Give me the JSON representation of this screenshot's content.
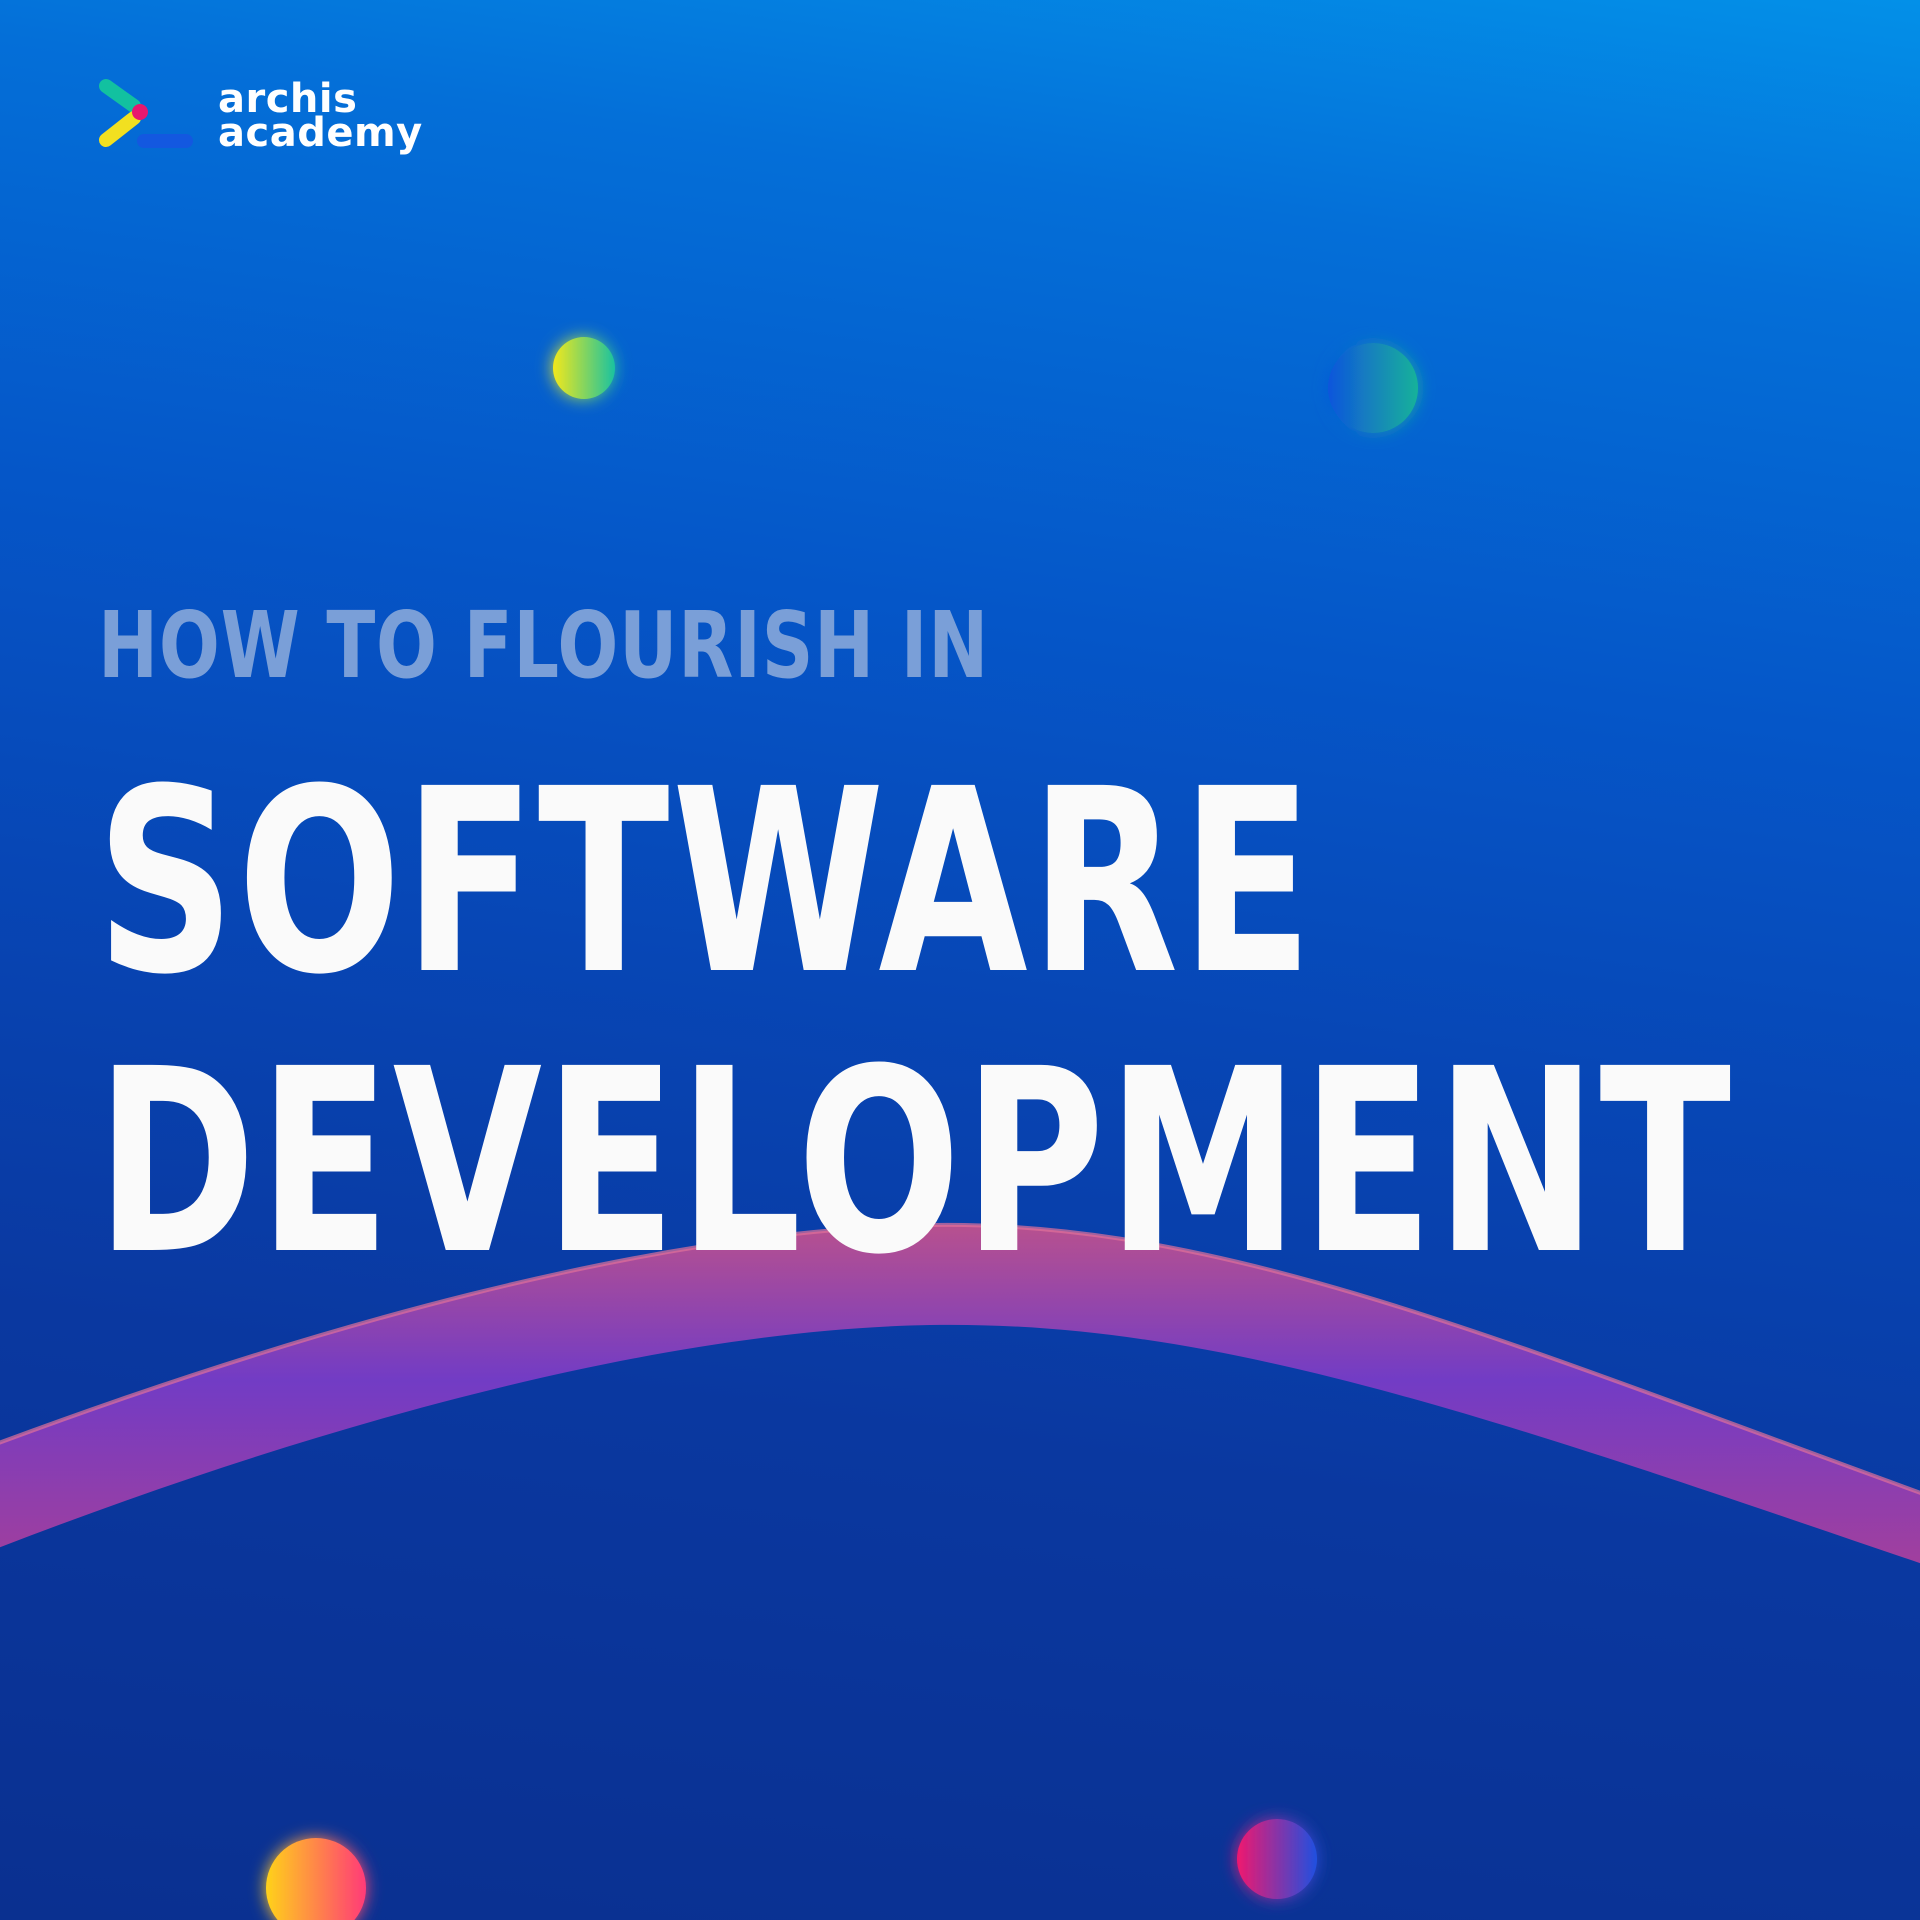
{
  "brand": {
    "line1": "archis",
    "line2": "academy",
    "colors": {
      "teal": "#12c1a0",
      "magenta": "#e8186e",
      "yellow": "#f2e020",
      "blue": "#1358e0"
    }
  },
  "headline": {
    "kicker": "HOW TO FLOURISH IN",
    "line1": "SOFTWARE",
    "line2": "DEVELOPMENT"
  },
  "colors": {
    "background_top": "#0390e8",
    "background_bottom": "#0a3090",
    "kicker_text": "#7a9fd8",
    "title_text": "#fafafa",
    "ribbon_start": "#7b3cc8",
    "ribbon_end": "#c04a9a"
  },
  "decorations": [
    {
      "name": "green-yellow-orb",
      "from": "#f2e81c",
      "to": "#1ac2a0"
    },
    {
      "name": "blue-teal-orb",
      "from": "#0f55dc",
      "to": "#17b29a"
    },
    {
      "name": "yellow-pink-orb",
      "from": "#ffd21a",
      "to": "#ff3a78"
    },
    {
      "name": "pink-blue-orb",
      "from": "#f0186e",
      "to": "#1f50e0"
    }
  ]
}
